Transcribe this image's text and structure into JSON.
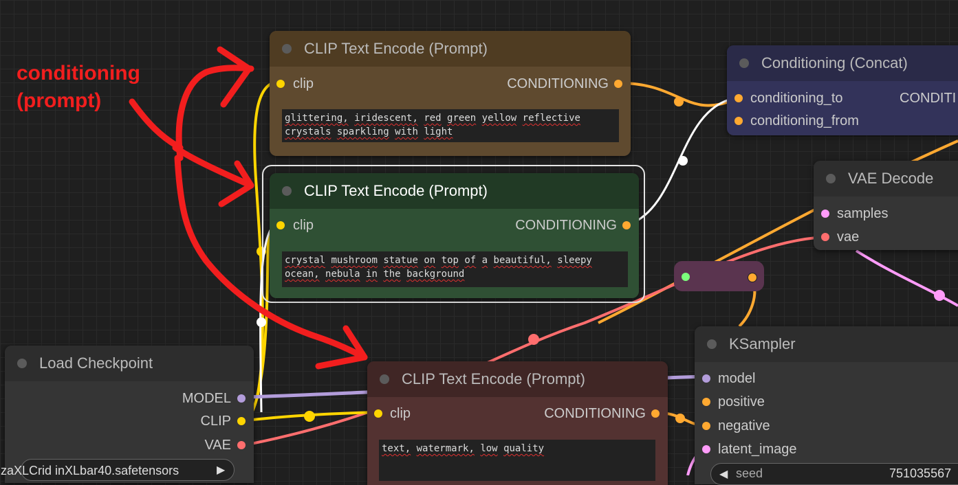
{
  "annotation": {
    "line1": "conditioning",
    "line2": "(prompt)"
  },
  "nodes": {
    "clip_top": {
      "title": "CLIP Text Encode (Prompt)",
      "input": "clip",
      "output": "CONDITIONING",
      "text": [
        "glittering,",
        "iridescent,",
        "red",
        "green",
        "yellow",
        "reflective",
        "crystals",
        "sparkling",
        "with",
        "light"
      ]
    },
    "clip_mid": {
      "title": "CLIP Text Encode (Prompt)",
      "input": "clip",
      "output": "CONDITIONING",
      "text": [
        "crystal",
        "mushroom",
        "statue",
        "on",
        "top",
        "of",
        "a",
        "beautiful,",
        "sleepy",
        "ocean,",
        "nebula",
        "in",
        "the",
        "background"
      ]
    },
    "clip_bottom": {
      "title": "CLIP Text Encode (Prompt)",
      "input": "clip",
      "output": "CONDITIONING",
      "text": [
        "text,",
        "watermark,",
        "low",
        "quality"
      ]
    },
    "concat": {
      "title": "Conditioning (Concat)",
      "input1": "conditioning_to",
      "input2": "conditioning_from",
      "output": "CONDITI"
    },
    "vae_decode": {
      "title": "VAE Decode",
      "input1": "samples",
      "input2": "vae"
    },
    "checkpoint": {
      "title": "Load Checkpoint",
      "out1": "MODEL",
      "out2": "CLIP",
      "out3": "VAE",
      "ckpt_name": "zaXLCrid inXLbar40.safetensors"
    },
    "ksampler": {
      "title": "KSampler",
      "in1": "model",
      "in2": "positive",
      "in3": "negative",
      "in4": "latent_image",
      "seed_label": "seed",
      "seed_value": "751035567"
    }
  }
}
